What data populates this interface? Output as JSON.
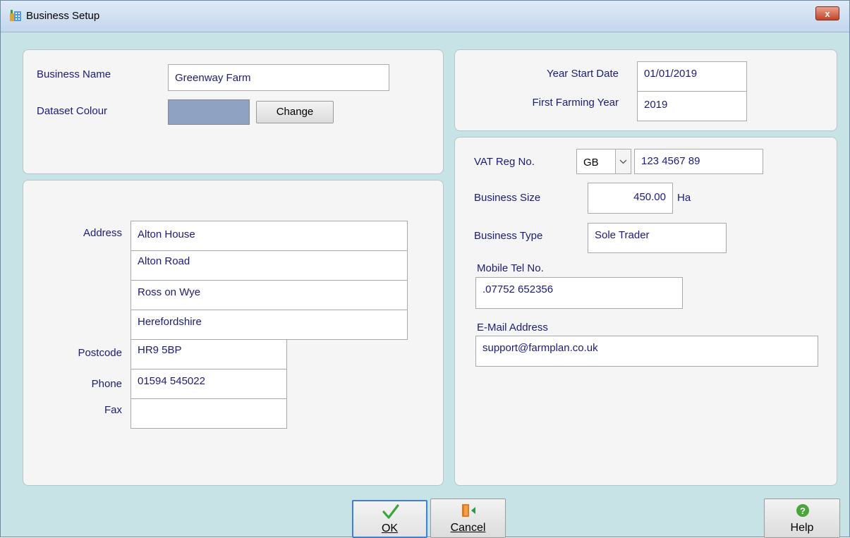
{
  "window": {
    "title": "Business Setup",
    "close_label": "x"
  },
  "left_top": {
    "business_name_label": "Business Name",
    "business_name_value": "Greenway Farm",
    "dataset_colour_label": "Dataset Colour",
    "dataset_colour_value": "#8fa2c2",
    "change_button": "Change"
  },
  "address": {
    "address_label": "Address",
    "lines": [
      "Alton House",
      "Alton Road",
      "Ross on Wye",
      "Herefordshire"
    ],
    "postcode_label": "Postcode",
    "postcode_value": "HR9 5BP",
    "phone_label": "Phone",
    "phone_value": "01594 545022",
    "fax_label": "Fax",
    "fax_value": ""
  },
  "year": {
    "year_start_label": "Year Start Date",
    "year_start_value": "01/01/2019",
    "first_year_label": "First Farming Year",
    "first_year_value": "2019"
  },
  "details": {
    "vat_label": "VAT Reg No.",
    "vat_country": "GB",
    "vat_number": "123 4567 89",
    "size_label": "Business Size",
    "size_value": "450.00",
    "size_unit": "Ha",
    "type_label": "Business Type",
    "type_value": "Sole Trader",
    "mobile_label": "Mobile Tel No.",
    "mobile_value": ".07752 652356",
    "email_label": "E-Mail Address",
    "email_value": "support@farmplan.co.uk"
  },
  "buttons": {
    "ok_label": "OK",
    "cancel_label": "Cancel",
    "help_label": "Help"
  }
}
